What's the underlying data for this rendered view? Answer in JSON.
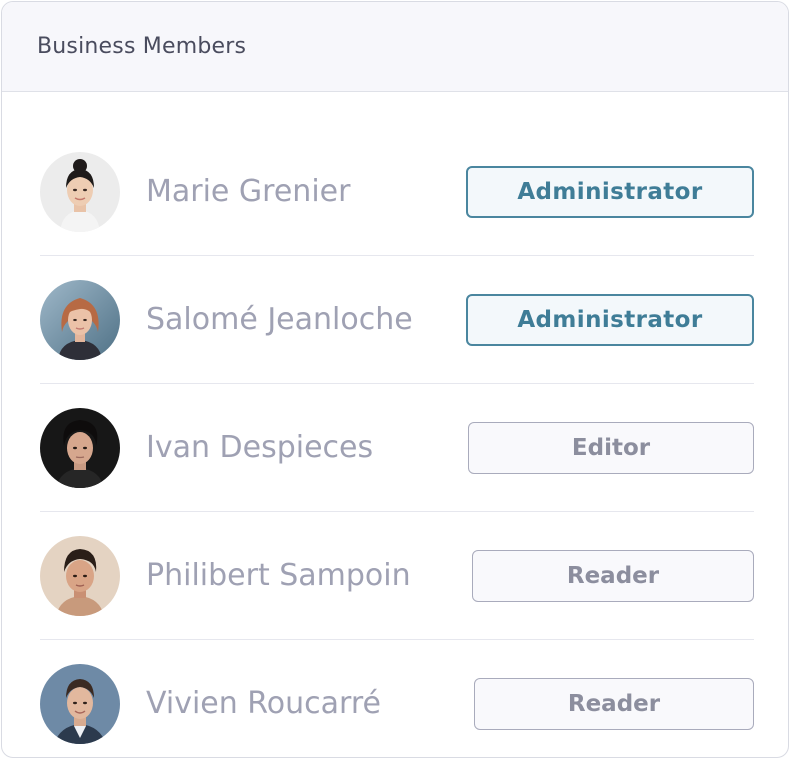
{
  "panel": {
    "title": "Business Members"
  },
  "members": [
    {
      "name": "Marie Grenier",
      "role": "Administrator"
    },
    {
      "name": "Salomé Jeanloche",
      "role": "Administrator"
    },
    {
      "name": "Ivan Despieces",
      "role": "Editor"
    },
    {
      "name": "Philibert Sampoin",
      "role": "Reader"
    },
    {
      "name": "Vivien Roucarré",
      "role": "Reader"
    }
  ],
  "colors": {
    "admin_accent": "#3f7d97",
    "neutral_text": "#9fa1b3",
    "header_background": "#f7f7fb"
  }
}
